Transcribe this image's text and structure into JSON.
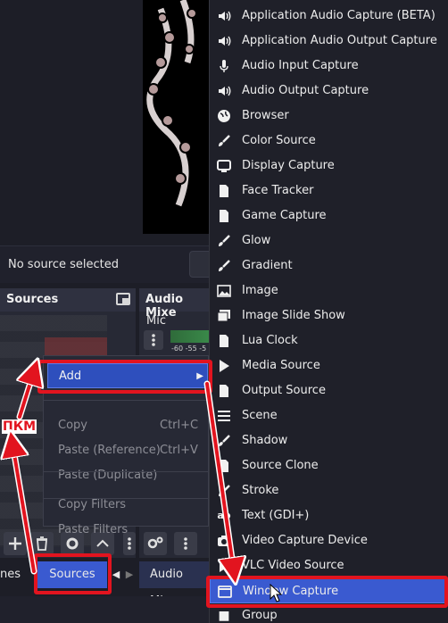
{
  "preview": {
    "status": "No source selected"
  },
  "sources_dock": {
    "title": "Sources"
  },
  "audio_dock": {
    "title": "Audio Mixe",
    "channel": "Mic",
    "scale": "-60  -55  -5"
  },
  "context_menu": {
    "items": [
      {
        "label": "Add",
        "shortcut": ""
      },
      {
        "label": "Copy",
        "shortcut": "Ctrl+C"
      },
      {
        "label": "Paste (Reference)",
        "shortcut": "Ctrl+V"
      },
      {
        "label": "Paste (Duplicate)",
        "shortcut": ""
      },
      {
        "label": "Copy Filters",
        "shortcut": ""
      },
      {
        "label": "Paste Filters",
        "shortcut": ""
      }
    ]
  },
  "submenu": {
    "items": [
      {
        "label": "Application Audio Capture (BETA)",
        "icon": "speaker-icon"
      },
      {
        "label": "Application Audio Output Capture",
        "icon": "speaker-icon"
      },
      {
        "label": "Audio Input Capture",
        "icon": "microphone-icon"
      },
      {
        "label": "Audio Output Capture",
        "icon": "speaker-icon"
      },
      {
        "label": "Browser",
        "icon": "globe-icon"
      },
      {
        "label": "Color Source",
        "icon": "brush-icon"
      },
      {
        "label": "Display Capture",
        "icon": "monitor-icon"
      },
      {
        "label": "Face Tracker",
        "icon": "file-icon"
      },
      {
        "label": "Game Capture",
        "icon": "gamepad-icon"
      },
      {
        "label": "Glow",
        "icon": "brush-icon"
      },
      {
        "label": "Gradient",
        "icon": "brush-icon"
      },
      {
        "label": "Image",
        "icon": "image-icon"
      },
      {
        "label": "Image Slide Show",
        "icon": "slideshow-icon"
      },
      {
        "label": "Lua Clock",
        "icon": "file-icon"
      },
      {
        "label": "Media Source",
        "icon": "play-icon"
      },
      {
        "label": "Output Source",
        "icon": "file-icon"
      },
      {
        "label": "Scene",
        "icon": "list-icon"
      },
      {
        "label": "Shadow",
        "icon": "brush-icon"
      },
      {
        "label": "Source Clone",
        "icon": "file-icon"
      },
      {
        "label": "Stroke",
        "icon": "brush-icon"
      },
      {
        "label": "Text (GDI+)",
        "icon": "text-icon"
      },
      {
        "label": "Video Capture Device",
        "icon": "camera-icon"
      },
      {
        "label": "VLC Video Source",
        "icon": "play-icon"
      },
      {
        "label": "Window Capture",
        "icon": "window-icon"
      },
      {
        "label": "Group",
        "icon": "folder-icon"
      }
    ]
  },
  "tabs": {
    "left_partial": "nes",
    "sources": "Sources",
    "audio": "Audio Mixe"
  },
  "annotation": {
    "label": "ПКМ",
    "color": "#e2141f"
  },
  "colors": {
    "accent": "#3a5ad0",
    "highlight": "#e2141f"
  }
}
